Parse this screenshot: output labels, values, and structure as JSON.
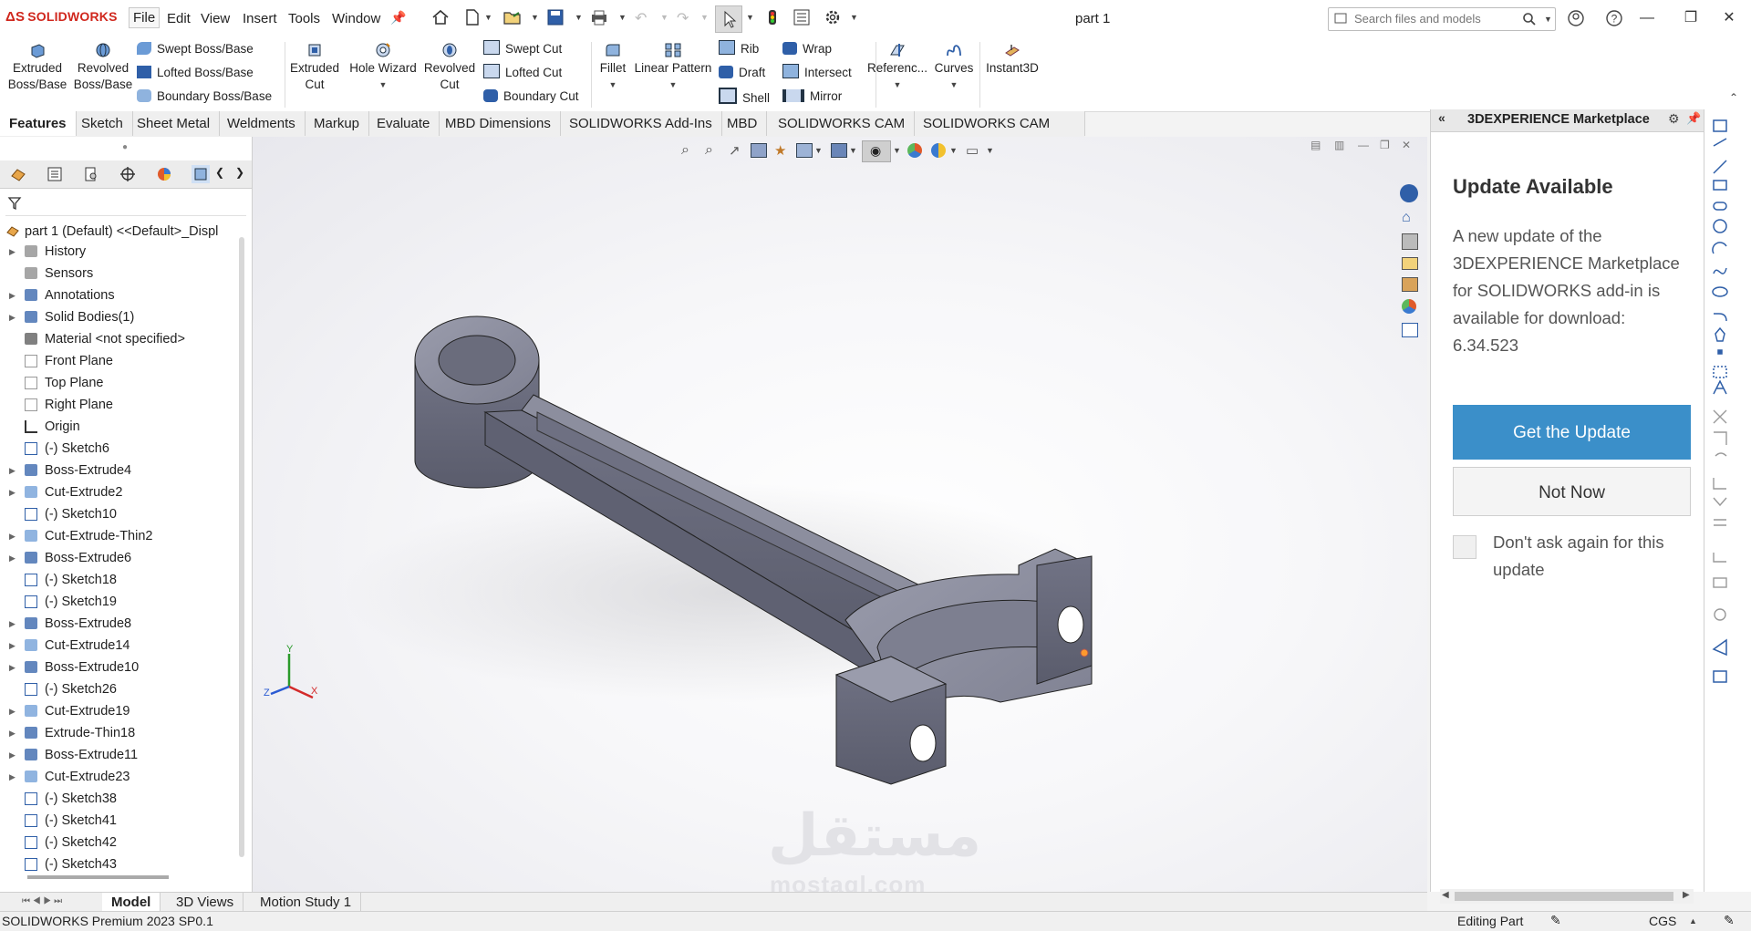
{
  "app": {
    "brand": "SOLIDWORKS",
    "document_title": "part 1"
  },
  "menus": [
    "File",
    "Edit",
    "View",
    "Insert",
    "Tools",
    "Window"
  ],
  "search": {
    "placeholder": "Search files and models"
  },
  "command_manager": {
    "extruded_boss": "Extruded\nBoss/Base",
    "revolved_boss": "Revolved\nBoss/Base",
    "swept_boss": "Swept Boss/Base",
    "lofted_boss": "Lofted Boss/Base",
    "boundary_boss": "Boundary Boss/Base",
    "extruded_cut": "Extruded\nCut",
    "hole_wizard": "Hole Wizard",
    "revolved_cut": "Revolved\nCut",
    "swept_cut": "Swept Cut",
    "lofted_cut": "Lofted Cut",
    "boundary_cut": "Boundary Cut",
    "fillet": "Fillet",
    "linear_pattern": "Linear Pattern",
    "rib": "Rib",
    "draft": "Draft",
    "shell": "Shell",
    "wrap": "Wrap",
    "intersect": "Intersect",
    "mirror": "Mirror",
    "reference": "Referenc...",
    "curves": "Curves",
    "instant3d": "Instant3D"
  },
  "tabs": [
    "Features",
    "Sketch",
    "Sheet Metal",
    "Weldments",
    "Markup",
    "Evaluate",
    "MBD Dimensions",
    "SOLIDWORKS Add-Ins",
    "MBD",
    "SOLIDWORKS CAM",
    "SOLIDWORKS CAM TBM"
  ],
  "tree": {
    "root": "part 1 (Default) <<Default>_Displ",
    "items": [
      {
        "label": "History",
        "expandable": true,
        "icon": "history-icon"
      },
      {
        "label": "Sensors",
        "expandable": false,
        "icon": "sensor-icon"
      },
      {
        "label": "Annotations",
        "expandable": true,
        "icon": "annotation-icon"
      },
      {
        "label": "Solid Bodies(1)",
        "expandable": true,
        "icon": "solid-bodies-icon"
      },
      {
        "label": "Material <not specified>",
        "expandable": false,
        "icon": "material-icon"
      },
      {
        "label": "Front Plane",
        "expandable": false,
        "icon": "plane-icon"
      },
      {
        "label": "Top Plane",
        "expandable": false,
        "icon": "plane-icon"
      },
      {
        "label": "Right Plane",
        "expandable": false,
        "icon": "plane-icon"
      },
      {
        "label": "Origin",
        "expandable": false,
        "icon": "origin-icon"
      },
      {
        "label": "(-) Sketch6",
        "expandable": false,
        "icon": "sketch-icon"
      },
      {
        "label": "Boss-Extrude4",
        "expandable": true,
        "icon": "extrude-icon"
      },
      {
        "label": "Cut-Extrude2",
        "expandable": true,
        "icon": "cut-icon"
      },
      {
        "label": "(-) Sketch10",
        "expandable": false,
        "icon": "sketch-icon"
      },
      {
        "label": "Cut-Extrude-Thin2",
        "expandable": true,
        "icon": "cut-icon"
      },
      {
        "label": "Boss-Extrude6",
        "expandable": true,
        "icon": "extrude-icon"
      },
      {
        "label": "(-) Sketch18",
        "expandable": false,
        "icon": "sketch-icon"
      },
      {
        "label": "(-) Sketch19",
        "expandable": false,
        "icon": "sketch-icon"
      },
      {
        "label": "Boss-Extrude8",
        "expandable": true,
        "icon": "extrude-icon"
      },
      {
        "label": "Cut-Extrude14",
        "expandable": true,
        "icon": "cut-icon"
      },
      {
        "label": "Boss-Extrude10",
        "expandable": true,
        "icon": "extrude-icon"
      },
      {
        "label": "(-) Sketch26",
        "expandable": false,
        "icon": "sketch-icon"
      },
      {
        "label": "Cut-Extrude19",
        "expandable": true,
        "icon": "cut-icon"
      },
      {
        "label": "Extrude-Thin18",
        "expandable": true,
        "icon": "extrude-icon"
      },
      {
        "label": "Boss-Extrude11",
        "expandable": true,
        "icon": "extrude-icon"
      },
      {
        "label": "Cut-Extrude23",
        "expandable": true,
        "icon": "cut-icon"
      },
      {
        "label": "(-) Sketch38",
        "expandable": false,
        "icon": "sketch-icon"
      },
      {
        "label": "(-) Sketch41",
        "expandable": false,
        "icon": "sketch-icon"
      },
      {
        "label": "(-) Sketch42",
        "expandable": false,
        "icon": "sketch-icon"
      },
      {
        "label": "(-) Sketch43",
        "expandable": false,
        "icon": "sketch-icon"
      }
    ]
  },
  "triad": {
    "x": "X",
    "y": "Y",
    "z": "Z"
  },
  "watermark": {
    "arabic": "مستقل",
    "latin": "mostaql.com"
  },
  "right_panel": {
    "title": "3DEXPERIENCE Marketplace",
    "heading": "Update Available",
    "message": "A new update of the 3DEXPERIENCE Marketplace for SOLIDWORKS add-in is available for download: 6.34.523",
    "primary_button": "Get the Update",
    "secondary_button": "Not Now",
    "checkbox_label": "Don't ask again for this update"
  },
  "bottom_tabs": [
    "Model",
    "3D Views",
    "Motion Study 1"
  ],
  "status": {
    "left": "SOLIDWORKS Premium 2023 SP0.1",
    "editing": "Editing Part",
    "units": "CGS"
  },
  "colors": {
    "accent": "#3b8fc9",
    "brand_red": "#d0271d",
    "part_face": "#8a8c9c"
  }
}
